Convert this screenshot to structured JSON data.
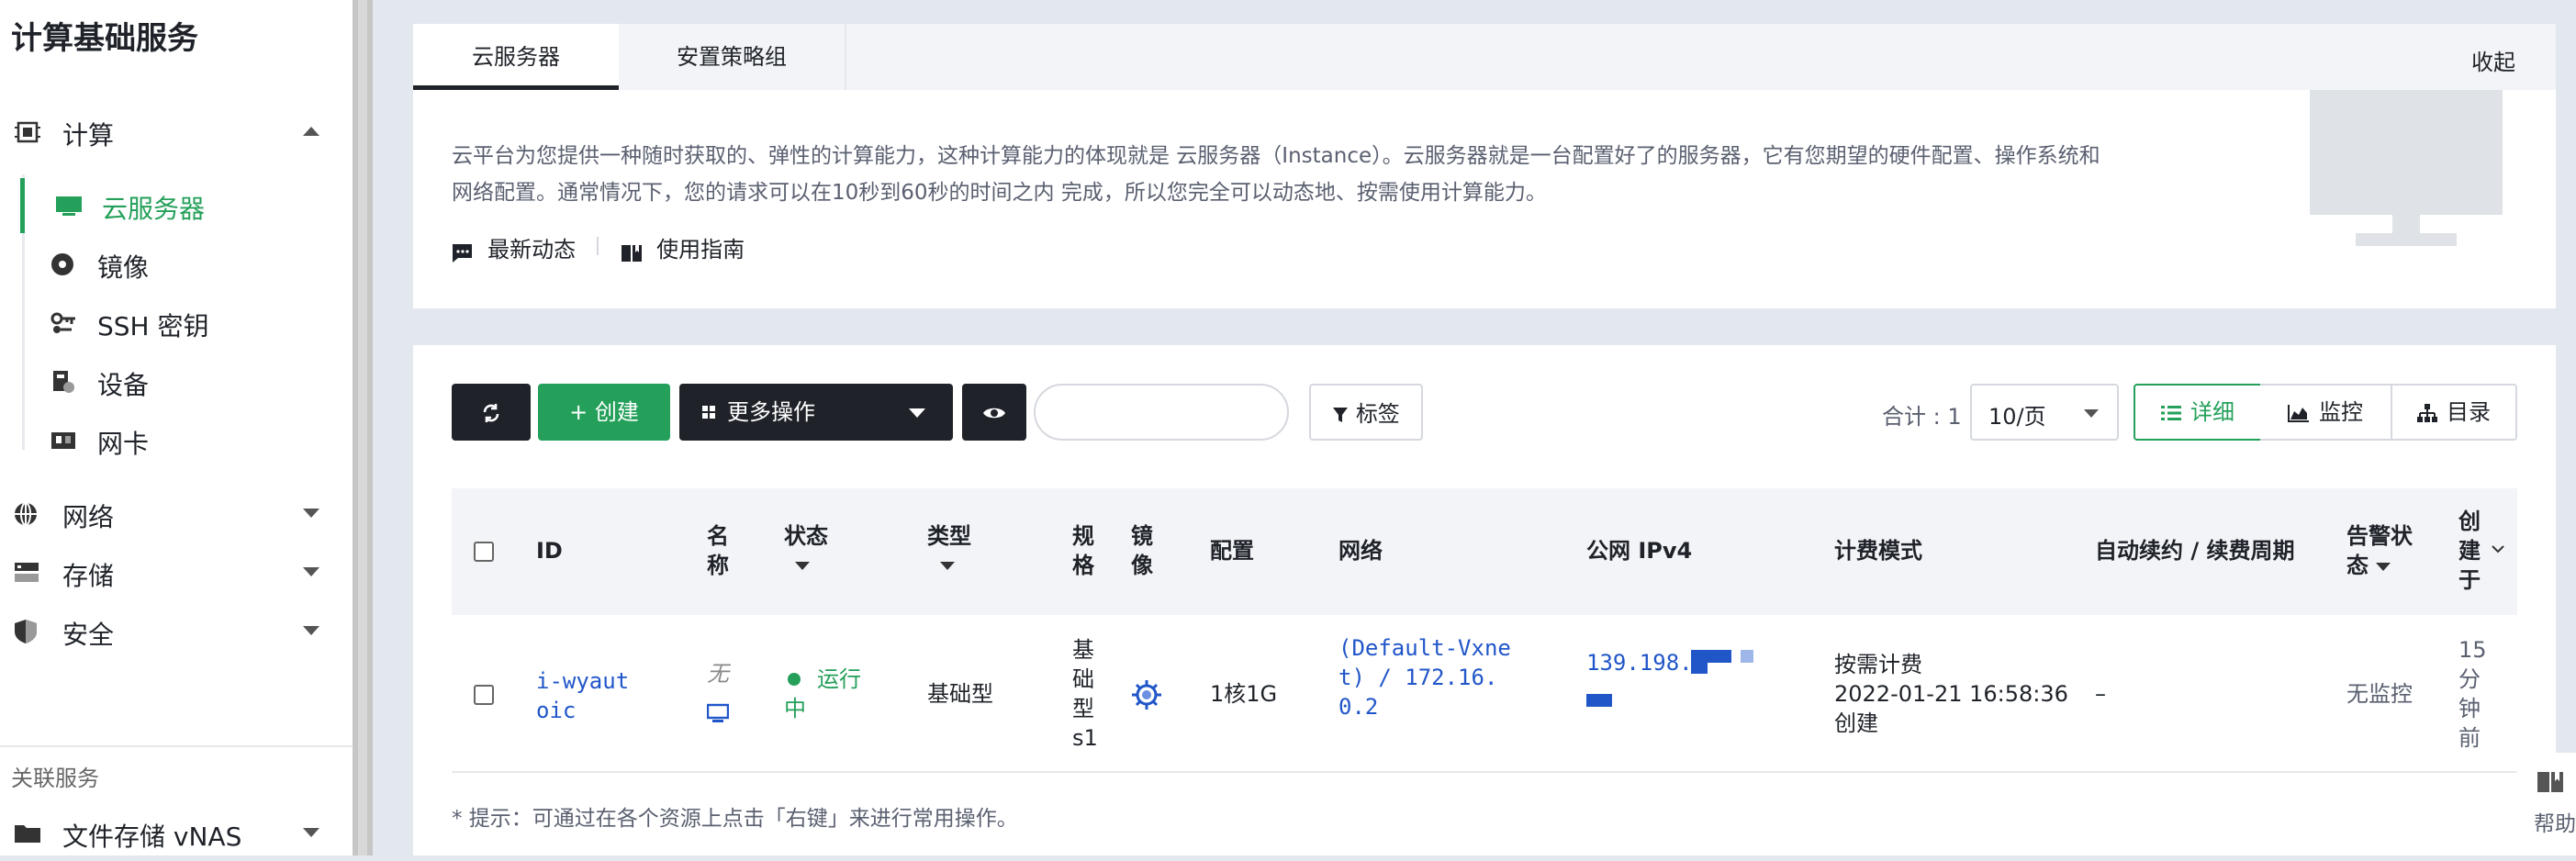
{
  "sidebar": {
    "title": "计算基础服务",
    "groups": {
      "compute": "计算",
      "network": "网络",
      "storage": "存储",
      "security": "安全"
    },
    "compute_items": [
      "云服务器",
      "镜像",
      "SSH 密钥",
      "设备",
      "网卡"
    ],
    "related_title": "关联服务",
    "related_item": "文件存储 vNAS"
  },
  "tabs": [
    "云服务器",
    "安置策略组"
  ],
  "collapse_label": "收起",
  "intro": {
    "line1": "云平台为您提供一种随时获取的、弹性的计算能力，这种计算能力的体现就是 云服务器（Instance）。云服务器就是一台配置好了的服务器，它有您期望的硬件配置、操作系统和",
    "line2": "网络配置。通常情况下，您的请求可以在10秒到60秒的时间之内 完成，所以您完全可以动态地、按需使用计算能力。",
    "news_link": "最新动态",
    "guide_link": "使用指南"
  },
  "toolbar": {
    "create_label": "+ 创建",
    "more_label": "更多操作",
    "search_placeholder": "",
    "tag_label": "标签",
    "total_label": "合计 : 1",
    "page_size": "10/页",
    "view_detail": "详细",
    "view_monitor": "监控",
    "view_catalog": "目录"
  },
  "table": {
    "headers": {
      "id": "ID",
      "name": [
        "名",
        "称"
      ],
      "status": "状态",
      "type": "类型",
      "spec": [
        "规",
        "格"
      ],
      "image": [
        "镜",
        "像"
      ],
      "config": "配置",
      "network": "网络",
      "ipv4": "公网 IPv4",
      "billing": "计费模式",
      "renew": "自动续约 / 续费周期",
      "alarm": [
        "告警状",
        "态"
      ],
      "created": [
        "创",
        "建",
        "于"
      ]
    },
    "row": {
      "id": [
        "i-wyaut",
        "oic"
      ],
      "name": "无",
      "status_a": "运行",
      "status_b": "中",
      "type": "基础型",
      "spec": [
        "基",
        "础",
        "型",
        "s1"
      ],
      "config": "1核1G",
      "network": [
        "(Default-Vxne",
        "t) / 172.16.",
        "0.2"
      ],
      "ipv4": "139.198.",
      "billing": [
        "按需计费",
        "2022-01-21 16:58:36",
        "创建"
      ],
      "renew": "–",
      "alarm": "无监控",
      "created": [
        "15",
        "分",
        "钟",
        "前"
      ]
    }
  },
  "hint": "* 提示：可通过在各个资源上点击「右键」来进行常用操作。",
  "help_label": "帮助",
  "colors": {
    "accent": "#24a05a",
    "dark": "#1f2329",
    "link": "#2156c9"
  }
}
